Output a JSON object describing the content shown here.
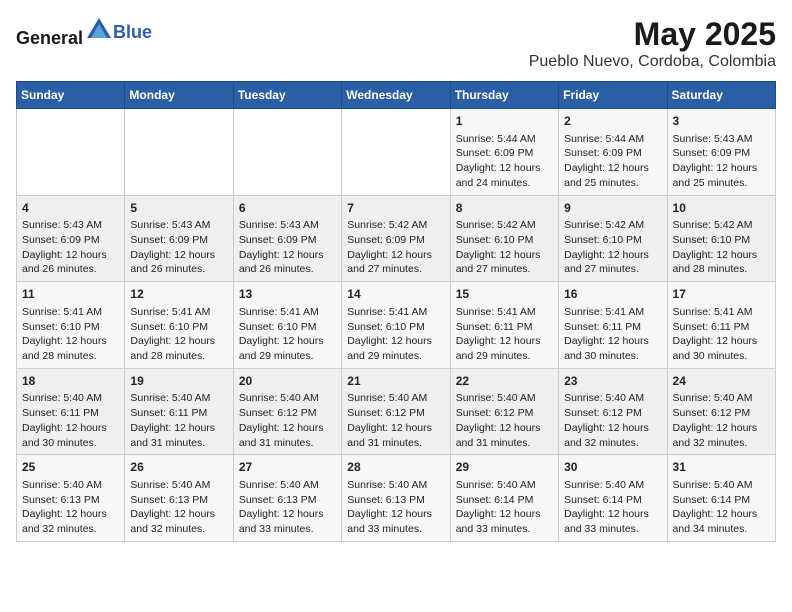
{
  "header": {
    "logo_general": "General",
    "logo_blue": "Blue",
    "month_title": "May 2025",
    "location": "Pueblo Nuevo, Cordoba, Colombia"
  },
  "weekdays": [
    "Sunday",
    "Monday",
    "Tuesday",
    "Wednesday",
    "Thursday",
    "Friday",
    "Saturday"
  ],
  "weeks": [
    [
      {
        "day": "",
        "sunrise": "",
        "sunset": "",
        "daylight": ""
      },
      {
        "day": "",
        "sunrise": "",
        "sunset": "",
        "daylight": ""
      },
      {
        "day": "",
        "sunrise": "",
        "sunset": "",
        "daylight": ""
      },
      {
        "day": "",
        "sunrise": "",
        "sunset": "",
        "daylight": ""
      },
      {
        "day": "1",
        "sunrise": "Sunrise: 5:44 AM",
        "sunset": "Sunset: 6:09 PM",
        "daylight": "Daylight: 12 hours and 24 minutes."
      },
      {
        "day": "2",
        "sunrise": "Sunrise: 5:44 AM",
        "sunset": "Sunset: 6:09 PM",
        "daylight": "Daylight: 12 hours and 25 minutes."
      },
      {
        "day": "3",
        "sunrise": "Sunrise: 5:43 AM",
        "sunset": "Sunset: 6:09 PM",
        "daylight": "Daylight: 12 hours and 25 minutes."
      }
    ],
    [
      {
        "day": "4",
        "sunrise": "Sunrise: 5:43 AM",
        "sunset": "Sunset: 6:09 PM",
        "daylight": "Daylight: 12 hours and 26 minutes."
      },
      {
        "day": "5",
        "sunrise": "Sunrise: 5:43 AM",
        "sunset": "Sunset: 6:09 PM",
        "daylight": "Daylight: 12 hours and 26 minutes."
      },
      {
        "day": "6",
        "sunrise": "Sunrise: 5:43 AM",
        "sunset": "Sunset: 6:09 PM",
        "daylight": "Daylight: 12 hours and 26 minutes."
      },
      {
        "day": "7",
        "sunrise": "Sunrise: 5:42 AM",
        "sunset": "Sunset: 6:09 PM",
        "daylight": "Daylight: 12 hours and 27 minutes."
      },
      {
        "day": "8",
        "sunrise": "Sunrise: 5:42 AM",
        "sunset": "Sunset: 6:10 PM",
        "daylight": "Daylight: 12 hours and 27 minutes."
      },
      {
        "day": "9",
        "sunrise": "Sunrise: 5:42 AM",
        "sunset": "Sunset: 6:10 PM",
        "daylight": "Daylight: 12 hours and 27 minutes."
      },
      {
        "day": "10",
        "sunrise": "Sunrise: 5:42 AM",
        "sunset": "Sunset: 6:10 PM",
        "daylight": "Daylight: 12 hours and 28 minutes."
      }
    ],
    [
      {
        "day": "11",
        "sunrise": "Sunrise: 5:41 AM",
        "sunset": "Sunset: 6:10 PM",
        "daylight": "Daylight: 12 hours and 28 minutes."
      },
      {
        "day": "12",
        "sunrise": "Sunrise: 5:41 AM",
        "sunset": "Sunset: 6:10 PM",
        "daylight": "Daylight: 12 hours and 28 minutes."
      },
      {
        "day": "13",
        "sunrise": "Sunrise: 5:41 AM",
        "sunset": "Sunset: 6:10 PM",
        "daylight": "Daylight: 12 hours and 29 minutes."
      },
      {
        "day": "14",
        "sunrise": "Sunrise: 5:41 AM",
        "sunset": "Sunset: 6:10 PM",
        "daylight": "Daylight: 12 hours and 29 minutes."
      },
      {
        "day": "15",
        "sunrise": "Sunrise: 5:41 AM",
        "sunset": "Sunset: 6:11 PM",
        "daylight": "Daylight: 12 hours and 29 minutes."
      },
      {
        "day": "16",
        "sunrise": "Sunrise: 5:41 AM",
        "sunset": "Sunset: 6:11 PM",
        "daylight": "Daylight: 12 hours and 30 minutes."
      },
      {
        "day": "17",
        "sunrise": "Sunrise: 5:41 AM",
        "sunset": "Sunset: 6:11 PM",
        "daylight": "Daylight: 12 hours and 30 minutes."
      }
    ],
    [
      {
        "day": "18",
        "sunrise": "Sunrise: 5:40 AM",
        "sunset": "Sunset: 6:11 PM",
        "daylight": "Daylight: 12 hours and 30 minutes."
      },
      {
        "day": "19",
        "sunrise": "Sunrise: 5:40 AM",
        "sunset": "Sunset: 6:11 PM",
        "daylight": "Daylight: 12 hours and 31 minutes."
      },
      {
        "day": "20",
        "sunrise": "Sunrise: 5:40 AM",
        "sunset": "Sunset: 6:12 PM",
        "daylight": "Daylight: 12 hours and 31 minutes."
      },
      {
        "day": "21",
        "sunrise": "Sunrise: 5:40 AM",
        "sunset": "Sunset: 6:12 PM",
        "daylight": "Daylight: 12 hours and 31 minutes."
      },
      {
        "day": "22",
        "sunrise": "Sunrise: 5:40 AM",
        "sunset": "Sunset: 6:12 PM",
        "daylight": "Daylight: 12 hours and 31 minutes."
      },
      {
        "day": "23",
        "sunrise": "Sunrise: 5:40 AM",
        "sunset": "Sunset: 6:12 PM",
        "daylight": "Daylight: 12 hours and 32 minutes."
      },
      {
        "day": "24",
        "sunrise": "Sunrise: 5:40 AM",
        "sunset": "Sunset: 6:12 PM",
        "daylight": "Daylight: 12 hours and 32 minutes."
      }
    ],
    [
      {
        "day": "25",
        "sunrise": "Sunrise: 5:40 AM",
        "sunset": "Sunset: 6:13 PM",
        "daylight": "Daylight: 12 hours and 32 minutes."
      },
      {
        "day": "26",
        "sunrise": "Sunrise: 5:40 AM",
        "sunset": "Sunset: 6:13 PM",
        "daylight": "Daylight: 12 hours and 32 minutes."
      },
      {
        "day": "27",
        "sunrise": "Sunrise: 5:40 AM",
        "sunset": "Sunset: 6:13 PM",
        "daylight": "Daylight: 12 hours and 33 minutes."
      },
      {
        "day": "28",
        "sunrise": "Sunrise: 5:40 AM",
        "sunset": "Sunset: 6:13 PM",
        "daylight": "Daylight: 12 hours and 33 minutes."
      },
      {
        "day": "29",
        "sunrise": "Sunrise: 5:40 AM",
        "sunset": "Sunset: 6:14 PM",
        "daylight": "Daylight: 12 hours and 33 minutes."
      },
      {
        "day": "30",
        "sunrise": "Sunrise: 5:40 AM",
        "sunset": "Sunset: 6:14 PM",
        "daylight": "Daylight: 12 hours and 33 minutes."
      },
      {
        "day": "31",
        "sunrise": "Sunrise: 5:40 AM",
        "sunset": "Sunset: 6:14 PM",
        "daylight": "Daylight: 12 hours and 34 minutes."
      }
    ]
  ]
}
